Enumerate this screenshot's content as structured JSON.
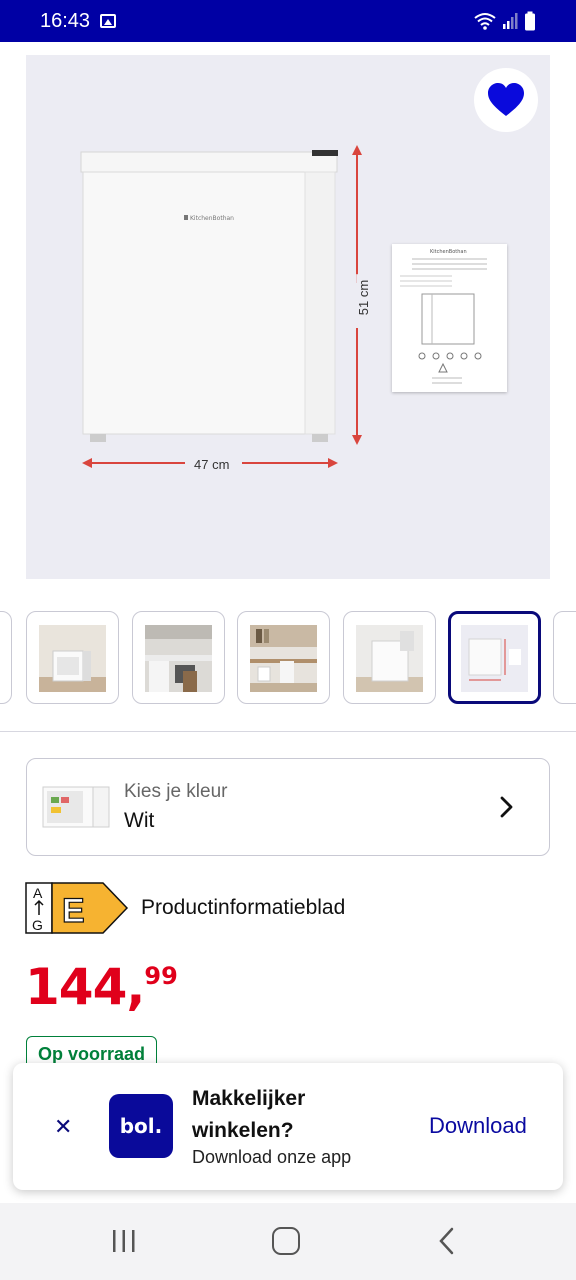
{
  "status_bar": {
    "time": "16:43"
  },
  "hero": {
    "width_label": "47 cm",
    "height_label": "51 cm",
    "favorite_icon": "heart-icon"
  },
  "thumbnails": {
    "count_visible": 6,
    "active_index": 5
  },
  "color_selector": {
    "label": "Kies je kleur",
    "value": "Wit",
    "icon": "chevron-right-icon"
  },
  "energy": {
    "scale_top": "A",
    "scale_bottom": "G",
    "class": "E",
    "class_color": "#f6b331",
    "link_text": "Productinformatieblad"
  },
  "price": {
    "main": "144,",
    "cents": "99",
    "color": "#e0001b"
  },
  "stock": {
    "label": "Op voorraad",
    "color": "#00803a"
  },
  "app_banner": {
    "logo_text": "bol.",
    "title": "Makkelijker winkelen?",
    "subtitle": "Download onze app",
    "download_label": "Download",
    "close_icon": "close-icon"
  },
  "colors": {
    "status_bar": "#0000a4",
    "brand": "#0a0a9a",
    "hero_bg": "#ececf3"
  }
}
